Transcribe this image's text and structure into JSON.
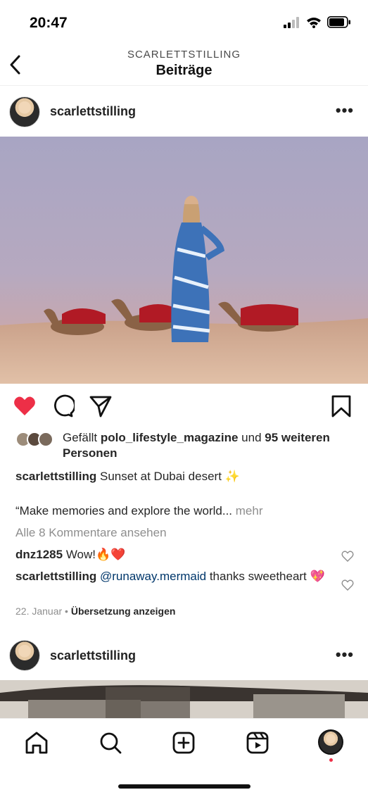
{
  "status_bar": {
    "time": "20:47"
  },
  "header": {
    "username": "SCARLETTSTILLING",
    "title": "Beiträge"
  },
  "post1": {
    "author": "scarlettstilling",
    "likes": {
      "prefix": "Gefällt ",
      "liked_by": "polo_lifestyle_magazine",
      "middle": " und ",
      "others": "95 weiteren Personen"
    },
    "caption": {
      "author": "scarlettstilling",
      "text": " Sunset at Dubai desert ✨"
    },
    "caption_more": {
      "text": "“Make memories and explore the world...",
      "more": " mehr"
    },
    "view_comments": "Alle 8 Kommentare ansehen",
    "comments": [
      {
        "author": "dnz1285",
        "text": " Wow!🔥❤️"
      },
      {
        "author": "scarlettstilling",
        "mention": " @runaway.mermaid",
        "text": " thanks sweetheart 💖"
      }
    ],
    "date": "22. Januar",
    "separator": " • ",
    "translate": "Übersetzung anzeigen"
  },
  "post2": {
    "author": "scarlettstilling"
  },
  "colors": {
    "like_red": "#ed2f47",
    "mention": "#00376b",
    "muted": "#8e8e8e"
  }
}
